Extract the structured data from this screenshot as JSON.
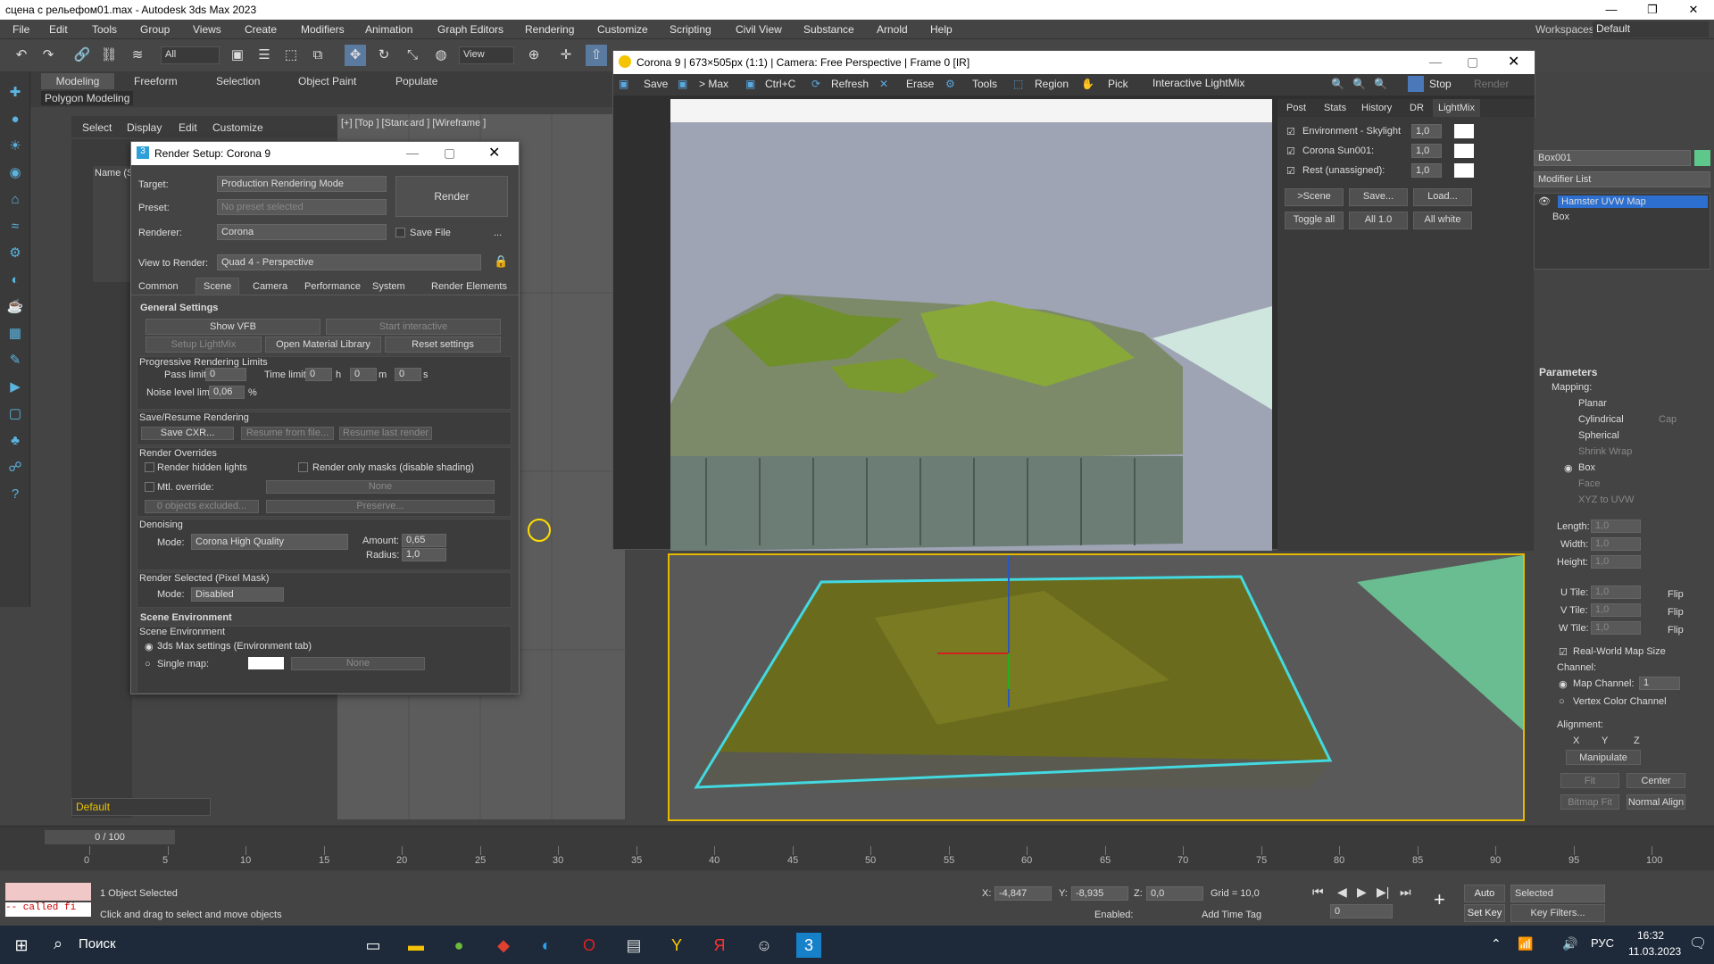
{
  "app": {
    "title": "сцена с рельефом01.max - Autodesk 3ds Max 2023",
    "workspaces_label": "Workspaces:",
    "workspace_value": "Default"
  },
  "menu": [
    "File",
    "Edit",
    "Tools",
    "Group",
    "Views",
    "Create",
    "Modifiers",
    "Animation",
    "Graph Editors",
    "Rendering",
    "Customize",
    "Scripting",
    "Civil View",
    "Substance",
    "Arnold",
    "Help"
  ],
  "toolbar": {
    "selection_filter": "All",
    "ref_coord": "View"
  },
  "ribbon": {
    "tabs": [
      "Modeling",
      "Freeform",
      "Selection",
      "Object Paint",
      "Populate"
    ],
    "sub": "Polygon Modeling"
  },
  "scene_explorer": {
    "menu": [
      "Select",
      "Display",
      "Edit",
      "Customize"
    ],
    "col_name": "Name (S"
  },
  "viewport_top_label": "[+] [Top ] [Standard ] [Wireframe ]",
  "render_setup": {
    "title": "Render Setup: Corona 9",
    "target_label": "Target:",
    "target_value": "Production Rendering Mode",
    "preset_label": "Preset:",
    "preset_value": "No preset selected",
    "renderer_label": "Renderer:",
    "renderer_value": "Corona",
    "save_file": "Save File",
    "render_btn": "Render",
    "more": "...",
    "view_label": "View to Render:",
    "view_value": "Quad 4 - Perspective",
    "tabs": [
      "Common",
      "Scene",
      "Camera",
      "Performance",
      "System",
      "Render Elements"
    ],
    "general": {
      "header": "General Settings",
      "show_vfb": "Show VFB",
      "start_interactive": "Start interactive",
      "setup_lightmix": "Setup LightMix",
      "open_mat_lib": "Open Material Library",
      "reset": "Reset settings",
      "prog_header": "Progressive Rendering Limits",
      "pass_limit_label": "Pass limit:",
      "pass_limit": "0",
      "time_limit_label": "Time limit:",
      "t_h": "0",
      "h": "h",
      "t_m": "0",
      "m": "m",
      "t_s": "0",
      "s": "s",
      "noise_label": "Noise level limit:",
      "noise": "0,06",
      "pct": "%",
      "save_resume_header": "Save/Resume Rendering",
      "save_cxr": "Save CXR...",
      "resume_file": "Resume from file...",
      "resume_last": "Resume last render",
      "overrides_header": "Render Overrides",
      "hidden_lights": "Render hidden lights",
      "only_masks": "Render only masks (disable shading)",
      "mtl_override": "Mtl. override:",
      "none": "None",
      "excluded": "0 objects excluded...",
      "preserve": "Preserve...",
      "denoise_header": "Denoising",
      "mode_label": "Mode:",
      "denoise_mode": "Corona High Quality",
      "amount_label": "Amount:",
      "amount": "0,65",
      "radius_label": "Radius:",
      "radius": "1,0",
      "rs_header": "Render Selected (Pixel Mask)",
      "rs_mode_label": "Mode:",
      "rs_mode": "Disabled"
    },
    "scene_env": {
      "header": "Scene Environment",
      "sub": "Scene Environment",
      "opt1": "3ds Max settings (Environment tab)",
      "opt2": "Single map:",
      "none": "None"
    }
  },
  "vfb": {
    "title": "Corona 9 | 673×505px (1:1) | Camera: Free Perspective | Frame 0 [IR]",
    "save": "Save",
    "to_max": "> Max",
    "ctrl_c": "Ctrl+C",
    "refresh": "Refresh",
    "erase": "Erase",
    "tools": "Tools",
    "region": "Region",
    "pick": "Pick",
    "lightmix_dropdown": "Interactive LightMix",
    "stop": "Stop",
    "render": "Render",
    "tabs": [
      "Post",
      "Stats",
      "History",
      "DR",
      "LightMix"
    ],
    "lights": [
      {
        "name": "Environment - Skylight",
        "value": "1,0"
      },
      {
        "name": "Corona Sun001:",
        "value": "1,0"
      },
      {
        "name": "Rest (unassigned):",
        "value": "1,0"
      }
    ],
    "btn_scene": ">Scene",
    "btn_save": "Save...",
    "btn_load": "Load...",
    "btn_toggle": "Toggle all",
    "btn_all1": "All 1.0",
    "btn_white": "All white"
  },
  "modify_panel": {
    "object_name": "Box001",
    "modifier_list": "Modifier List",
    "stack": [
      "Hamster UVW Map",
      "Box"
    ],
    "params_header": "Parameters",
    "mapping_label": "Mapping:",
    "mapping": [
      "Planar",
      "Cylindrical",
      "Spherical",
      "Shrink Wrap",
      "Box",
      "Face",
      "XYZ to UVW"
    ],
    "cap": "Cap",
    "length_label": "Length:",
    "length": "1,0",
    "width_label": "Width:",
    "width": "1,0",
    "height_label": "Height:",
    "height": "1,0",
    "utile_label": "U Tile:",
    "utile": "1,0",
    "vtile_label": "V Tile:",
    "vtile": "1,0",
    "wtile_label": "W Tile:",
    "wtile": "1,0",
    "flip": "Flip",
    "realworld": "Real-World Map Size",
    "channel_label": "Channel:",
    "map_channel": "Map Channel:",
    "map_channel_value": "1",
    "vertex_color": "Vertex Color Channel",
    "alignment_label": "Alignment:",
    "x": "X",
    "y": "Y",
    "z": "Z",
    "manipulate": "Manipulate",
    "fit": "Fit",
    "center": "Center",
    "bitmap_fit": "Bitmap Fit",
    "normal_align": "Normal Align"
  },
  "layer": "Default",
  "timeline": {
    "frame": "0 / 100",
    "ticks": [
      "0",
      "5",
      "10",
      "15",
      "20",
      "25",
      "30",
      "35",
      "40",
      "45",
      "50",
      "55",
      "60",
      "65",
      "70",
      "75",
      "80",
      "85",
      "90",
      "95",
      "100"
    ]
  },
  "status": {
    "script": "-- called fi",
    "selected": "1 Object Selected",
    "hint": "Click and drag to select and move objects",
    "x_label": "X:",
    "x": "-4,847",
    "y_label": "Y:",
    "y": "-8,935",
    "z_label": "Z:",
    "z": "0,0",
    "grid": "Grid = 10,0",
    "enabled": "Enabled:",
    "add_time_tag": "Add Time Tag",
    "auto_key": "Auto Key",
    "set_key": "Set Key",
    "key_mode": "Selected",
    "key_filters": "Key Filters...",
    "frame_value": "0"
  },
  "taskbar": {
    "search": "Поиск",
    "lang": "РУС",
    "time": "16:32",
    "date": "11.03.2023"
  }
}
